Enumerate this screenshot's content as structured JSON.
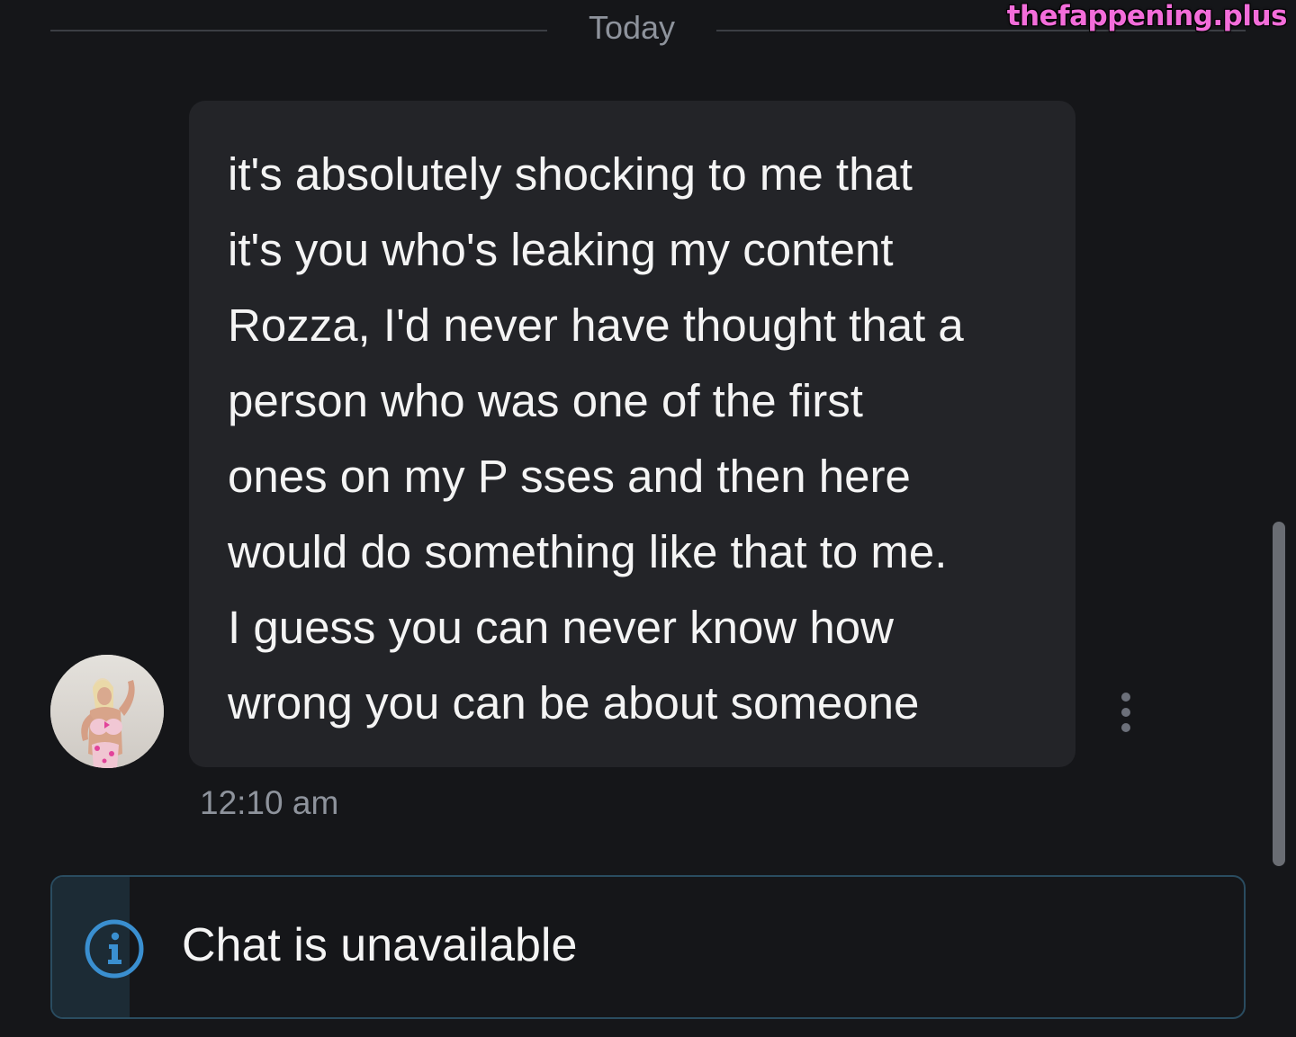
{
  "date_divider": {
    "label": "Today"
  },
  "watermark": {
    "text": "thefappening.plus"
  },
  "message": {
    "lines": [
      "it's absolutely shocking to me that",
      "it's you who's leaking my content",
      "Rozza, I'd never have thought that a",
      "person who was one of the first",
      "ones on my P sses and then here",
      "would do something like that to me.",
      "I guess you can never know how",
      "wrong you can be about someone"
    ],
    "timestamp": "12:10 am"
  },
  "status_bar": {
    "text": "Chat is unavailable",
    "icon": "info-icon",
    "accent_color": "#3a8fd0"
  },
  "colors": {
    "background": "#151619",
    "bubble": "#232428",
    "muted_text": "#8e939c",
    "watermark": "#f36dda"
  }
}
